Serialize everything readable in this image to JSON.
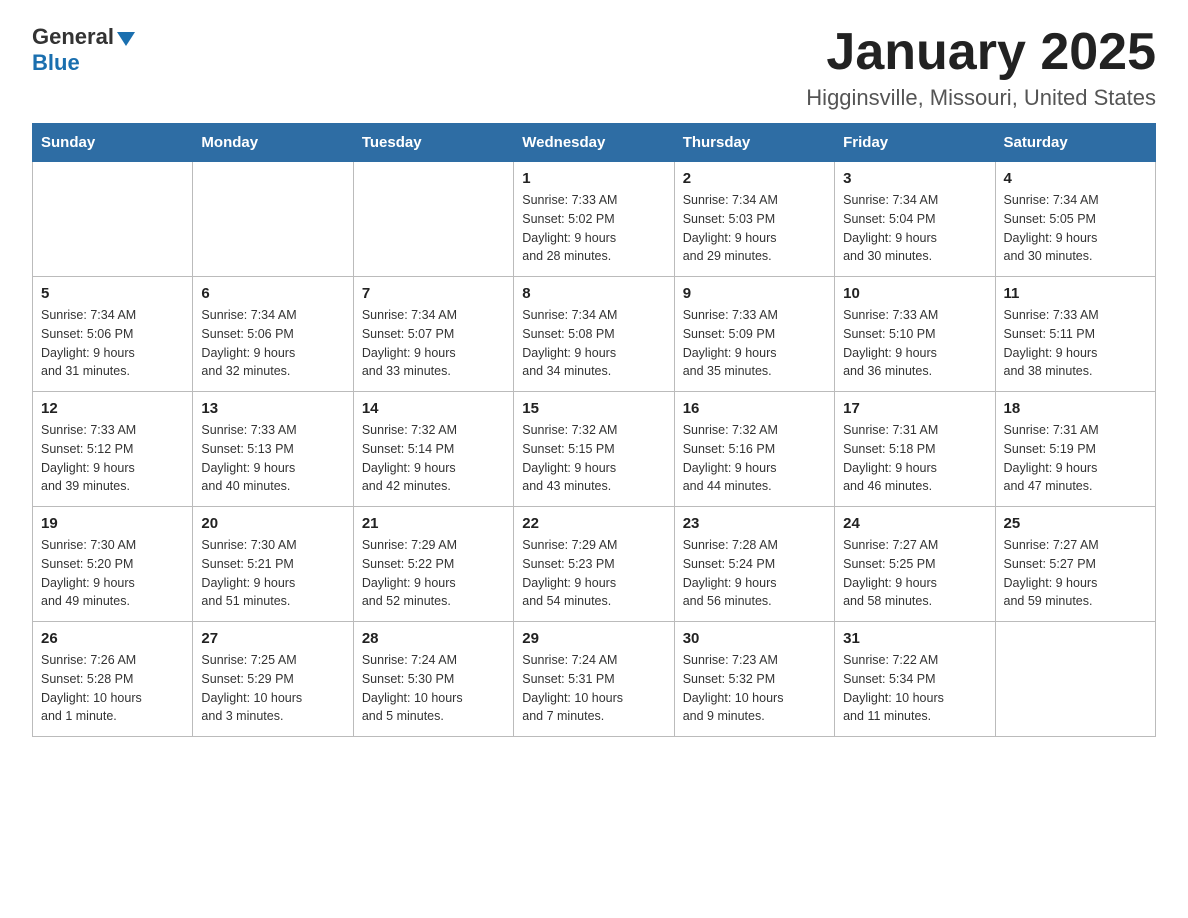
{
  "header": {
    "logo_general": "General",
    "logo_blue": "Blue",
    "month_title": "January 2025",
    "location": "Higginsville, Missouri, United States"
  },
  "days_of_week": [
    "Sunday",
    "Monday",
    "Tuesday",
    "Wednesday",
    "Thursday",
    "Friday",
    "Saturday"
  ],
  "weeks": [
    [
      {
        "day": "",
        "info": ""
      },
      {
        "day": "",
        "info": ""
      },
      {
        "day": "",
        "info": ""
      },
      {
        "day": "1",
        "info": "Sunrise: 7:33 AM\nSunset: 5:02 PM\nDaylight: 9 hours\nand 28 minutes."
      },
      {
        "day": "2",
        "info": "Sunrise: 7:34 AM\nSunset: 5:03 PM\nDaylight: 9 hours\nand 29 minutes."
      },
      {
        "day": "3",
        "info": "Sunrise: 7:34 AM\nSunset: 5:04 PM\nDaylight: 9 hours\nand 30 minutes."
      },
      {
        "day": "4",
        "info": "Sunrise: 7:34 AM\nSunset: 5:05 PM\nDaylight: 9 hours\nand 30 minutes."
      }
    ],
    [
      {
        "day": "5",
        "info": "Sunrise: 7:34 AM\nSunset: 5:06 PM\nDaylight: 9 hours\nand 31 minutes."
      },
      {
        "day": "6",
        "info": "Sunrise: 7:34 AM\nSunset: 5:06 PM\nDaylight: 9 hours\nand 32 minutes."
      },
      {
        "day": "7",
        "info": "Sunrise: 7:34 AM\nSunset: 5:07 PM\nDaylight: 9 hours\nand 33 minutes."
      },
      {
        "day": "8",
        "info": "Sunrise: 7:34 AM\nSunset: 5:08 PM\nDaylight: 9 hours\nand 34 minutes."
      },
      {
        "day": "9",
        "info": "Sunrise: 7:33 AM\nSunset: 5:09 PM\nDaylight: 9 hours\nand 35 minutes."
      },
      {
        "day": "10",
        "info": "Sunrise: 7:33 AM\nSunset: 5:10 PM\nDaylight: 9 hours\nand 36 minutes."
      },
      {
        "day": "11",
        "info": "Sunrise: 7:33 AM\nSunset: 5:11 PM\nDaylight: 9 hours\nand 38 minutes."
      }
    ],
    [
      {
        "day": "12",
        "info": "Sunrise: 7:33 AM\nSunset: 5:12 PM\nDaylight: 9 hours\nand 39 minutes."
      },
      {
        "day": "13",
        "info": "Sunrise: 7:33 AM\nSunset: 5:13 PM\nDaylight: 9 hours\nand 40 minutes."
      },
      {
        "day": "14",
        "info": "Sunrise: 7:32 AM\nSunset: 5:14 PM\nDaylight: 9 hours\nand 42 minutes."
      },
      {
        "day": "15",
        "info": "Sunrise: 7:32 AM\nSunset: 5:15 PM\nDaylight: 9 hours\nand 43 minutes."
      },
      {
        "day": "16",
        "info": "Sunrise: 7:32 AM\nSunset: 5:16 PM\nDaylight: 9 hours\nand 44 minutes."
      },
      {
        "day": "17",
        "info": "Sunrise: 7:31 AM\nSunset: 5:18 PM\nDaylight: 9 hours\nand 46 minutes."
      },
      {
        "day": "18",
        "info": "Sunrise: 7:31 AM\nSunset: 5:19 PM\nDaylight: 9 hours\nand 47 minutes."
      }
    ],
    [
      {
        "day": "19",
        "info": "Sunrise: 7:30 AM\nSunset: 5:20 PM\nDaylight: 9 hours\nand 49 minutes."
      },
      {
        "day": "20",
        "info": "Sunrise: 7:30 AM\nSunset: 5:21 PM\nDaylight: 9 hours\nand 51 minutes."
      },
      {
        "day": "21",
        "info": "Sunrise: 7:29 AM\nSunset: 5:22 PM\nDaylight: 9 hours\nand 52 minutes."
      },
      {
        "day": "22",
        "info": "Sunrise: 7:29 AM\nSunset: 5:23 PM\nDaylight: 9 hours\nand 54 minutes."
      },
      {
        "day": "23",
        "info": "Sunrise: 7:28 AM\nSunset: 5:24 PM\nDaylight: 9 hours\nand 56 minutes."
      },
      {
        "day": "24",
        "info": "Sunrise: 7:27 AM\nSunset: 5:25 PM\nDaylight: 9 hours\nand 58 minutes."
      },
      {
        "day": "25",
        "info": "Sunrise: 7:27 AM\nSunset: 5:27 PM\nDaylight: 9 hours\nand 59 minutes."
      }
    ],
    [
      {
        "day": "26",
        "info": "Sunrise: 7:26 AM\nSunset: 5:28 PM\nDaylight: 10 hours\nand 1 minute."
      },
      {
        "day": "27",
        "info": "Sunrise: 7:25 AM\nSunset: 5:29 PM\nDaylight: 10 hours\nand 3 minutes."
      },
      {
        "day": "28",
        "info": "Sunrise: 7:24 AM\nSunset: 5:30 PM\nDaylight: 10 hours\nand 5 minutes."
      },
      {
        "day": "29",
        "info": "Sunrise: 7:24 AM\nSunset: 5:31 PM\nDaylight: 10 hours\nand 7 minutes."
      },
      {
        "day": "30",
        "info": "Sunrise: 7:23 AM\nSunset: 5:32 PM\nDaylight: 10 hours\nand 9 minutes."
      },
      {
        "day": "31",
        "info": "Sunrise: 7:22 AM\nSunset: 5:34 PM\nDaylight: 10 hours\nand 11 minutes."
      },
      {
        "day": "",
        "info": ""
      }
    ]
  ]
}
